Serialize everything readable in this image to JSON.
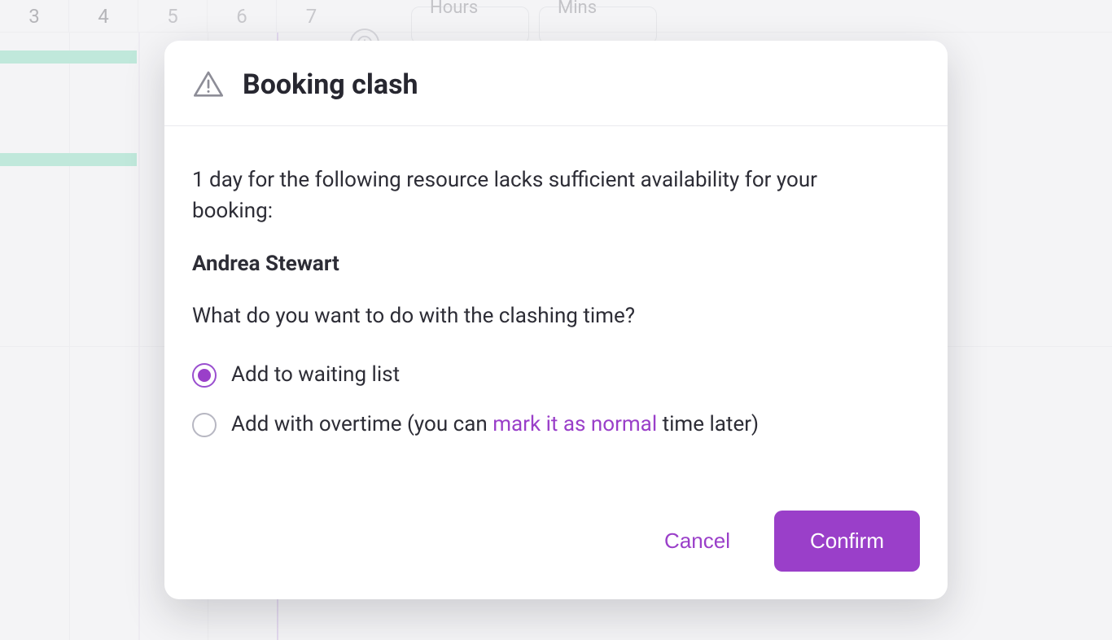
{
  "background": {
    "days": [
      "3",
      "4",
      "5",
      "6",
      "7"
    ],
    "fields": {
      "hours_label": "Hours",
      "mins_label": "Mins"
    }
  },
  "modal": {
    "title": "Booking clash",
    "lead": "1 day for the following resource lacks sufficient availability for your booking:",
    "resource_name": "Andrea Stewart",
    "followup": "What do you want to do with the clashing time?",
    "options": {
      "waiting_list": "Add to waiting list",
      "overtime_pre": "Add with overtime (you can ",
      "overtime_link": "mark it as normal",
      "overtime_post": " time later)"
    },
    "selected_option": "waiting_list",
    "buttons": {
      "cancel": "Cancel",
      "confirm": "Confirm"
    }
  }
}
